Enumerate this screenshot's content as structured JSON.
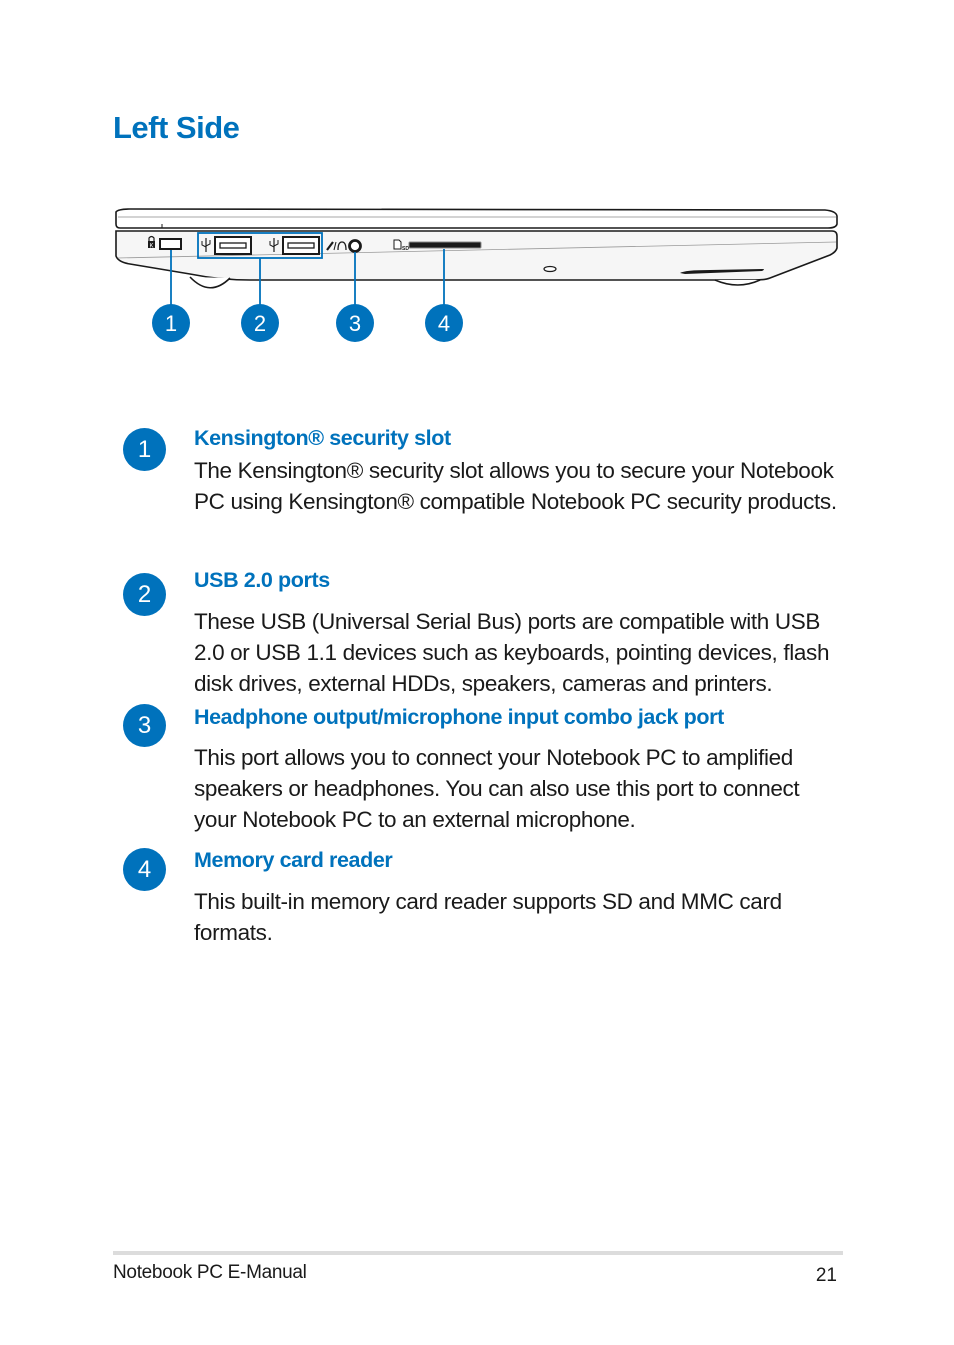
{
  "page": {
    "title": "Left Side"
  },
  "diagram": {
    "callouts": [
      "1",
      "2",
      "3",
      "4"
    ],
    "port_icons": {
      "kensington": "kensington-lock-icon",
      "usb": "usb-icon",
      "audio": "headphone-mic-icon",
      "card": "sd-card-icon"
    },
    "accent_color": "#0072bc"
  },
  "items": [
    {
      "number": "1",
      "heading": "Kensington® security slot",
      "body": "The Kensington® security slot allows you to secure your Notebook PC using Kensington® compatible Notebook PC security products."
    },
    {
      "number": "2",
      "heading": "USB 2.0 ports",
      "body": "These USB (Universal Serial Bus) ports are compatible with USB 2.0 or USB 1.1 devices such as keyboards, pointing devices, flash disk drives, external HDDs, speakers, cameras and printers."
    },
    {
      "number": "3",
      "heading": "Headphone output/microphone input combo jack port",
      "body": "This port allows you to connect your Notebook PC to amplified speakers or headphones. You can also use this port to connect your Notebook PC to an external microphone."
    },
    {
      "number": "4",
      "heading": "Memory card reader",
      "body": "This built-in memory card reader supports SD and MMC card formats."
    }
  ],
  "footer": {
    "title": "Notebook PC E-Manual",
    "page_number": "21"
  },
  "colors": {
    "accent": "#0072bc",
    "text": "#1a1a1a",
    "footer_rule": "#dcdcdc"
  }
}
